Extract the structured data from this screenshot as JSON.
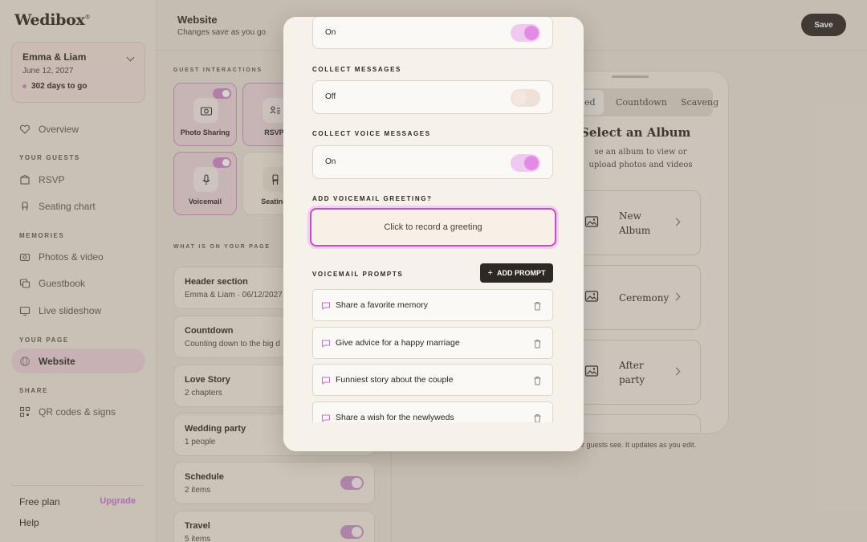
{
  "brand": {
    "logo": "Wedibox",
    "logo_mark": "®"
  },
  "event": {
    "name": "Emma & Liam",
    "date": "June 12, 2027",
    "countdown": "302 days to go"
  },
  "nav": {
    "overview": "Overview",
    "sections": [
      "YOUR GUESTS",
      "MEMORIES",
      "YOUR PAGE",
      "SHARE"
    ],
    "items": [
      {
        "label": "RSVP",
        "icon": "rsvp-icon"
      },
      {
        "label": "Seating chart",
        "icon": "seat-icon"
      },
      {
        "label": "Photos & video",
        "icon": "camera-icon"
      },
      {
        "label": "Guestbook",
        "icon": "guestbook-icon"
      },
      {
        "label": "Live slideshow",
        "icon": "monitor-icon"
      },
      {
        "label": "Website",
        "icon": "globe-icon",
        "active": true
      },
      {
        "label": "QR codes & signs",
        "icon": "qr-icon"
      }
    ],
    "plan": "Free plan",
    "upgrade": "Upgrade",
    "help": "Help"
  },
  "topbar": {
    "title": "Website",
    "subtitle": "Changes save as you go",
    "save": "Save"
  },
  "middle": {
    "guest_interactions_label": "GUEST INTERACTIONS",
    "tiles": [
      {
        "label": "Photo Sharing",
        "on": true
      },
      {
        "label": "RSVP",
        "on": true
      },
      {
        "label": "Voicemail",
        "on": true
      },
      {
        "label": "Seating",
        "on": false
      }
    ],
    "page_label": "WHAT IS ON YOUR PAGE",
    "sections": [
      {
        "title": "Header section",
        "subtitle": "Emma & Liam · 06/12/2027"
      },
      {
        "title": "Countdown",
        "subtitle": "Counting down to the big d"
      },
      {
        "title": "Love Story",
        "subtitle": "2 chapters"
      },
      {
        "title": "Wedding party",
        "subtitle": "1 people"
      },
      {
        "title": "Schedule",
        "subtitle": "2 items"
      },
      {
        "title": "Travel",
        "subtitle": "5 items"
      }
    ]
  },
  "preview": {
    "tabs": [
      "ed",
      "Countdown",
      "Scaveng"
    ],
    "title": "Select an Album",
    "description": "se an album to view or upload photos and videos",
    "albums": [
      {
        "line1": "New",
        "line2": "Album"
      },
      {
        "line1": "Ceremony",
        "line2": ""
      },
      {
        "line1": "After",
        "line2": "party"
      }
    ],
    "note": "ur guests see. It updates as you edit."
  },
  "modal": {
    "top_value": "On",
    "collect_messages_label": "COLLECT MESSAGES",
    "collect_messages_value": "Off",
    "collect_voice_label": "COLLECT VOICE MESSAGES",
    "collect_voice_value": "On",
    "greeting_label": "ADD VOICEMAIL GREETING?",
    "greeting_button": "Click to record a greeting",
    "prompts_label": "VOICEMAIL PROMPTS",
    "add_prompt": "ADD PROMPT",
    "prompts": [
      "Share a favorite memory",
      "Give advice for a happy marriage",
      "Funniest story about the couple",
      "Share a wish for the newlyweds"
    ]
  }
}
